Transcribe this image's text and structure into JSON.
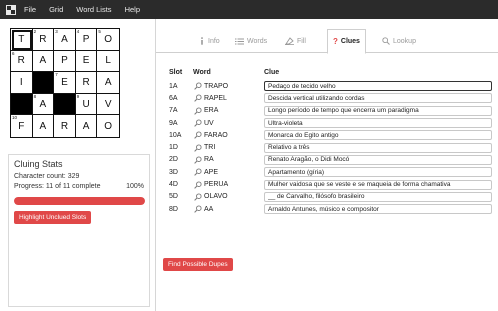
{
  "menu": {
    "items": [
      "File",
      "Grid",
      "Word Lists",
      "Help"
    ]
  },
  "grid": {
    "cells": [
      {
        "letter": "T",
        "num": "1",
        "black": false,
        "selected": true
      },
      {
        "letter": "R",
        "num": "2",
        "black": false
      },
      {
        "letter": "A",
        "num": "3",
        "black": false
      },
      {
        "letter": "P",
        "num": "4",
        "black": false
      },
      {
        "letter": "O",
        "num": "5",
        "black": false
      },
      {
        "letter": "R",
        "num": "6",
        "black": false
      },
      {
        "letter": "A",
        "num": "",
        "black": false
      },
      {
        "letter": "P",
        "num": "",
        "black": false
      },
      {
        "letter": "E",
        "num": "",
        "black": false
      },
      {
        "letter": "L",
        "num": "",
        "black": false
      },
      {
        "letter": "I",
        "num": "",
        "black": false
      },
      {
        "letter": "",
        "num": "",
        "black": true
      },
      {
        "letter": "E",
        "num": "7",
        "black": false
      },
      {
        "letter": "R",
        "num": "",
        "black": false
      },
      {
        "letter": "A",
        "num": "",
        "black": false
      },
      {
        "letter": "",
        "num": "",
        "black": true
      },
      {
        "letter": "A",
        "num": "8",
        "black": false
      },
      {
        "letter": "",
        "num": "",
        "black": true
      },
      {
        "letter": "U",
        "num": "9",
        "black": false
      },
      {
        "letter": "V",
        "num": "",
        "black": false
      },
      {
        "letter": "F",
        "num": "10",
        "black": false
      },
      {
        "letter": "A",
        "num": "",
        "black": false
      },
      {
        "letter": "R",
        "num": "",
        "black": false
      },
      {
        "letter": "A",
        "num": "",
        "black": false
      },
      {
        "letter": "O",
        "num": "",
        "black": false
      }
    ]
  },
  "stats": {
    "title": "Cluing Stats",
    "character_count": "Character count: 329",
    "progress_text": "Progress: 11 of 11 complete",
    "progress_percent": "100%",
    "progress_fraction": 1.0,
    "highlight_button": "Highlight Unclued Slots"
  },
  "tabs": [
    {
      "label": "Info",
      "icon": "info-icon",
      "active": false
    },
    {
      "label": "Words",
      "icon": "list-icon",
      "active": false
    },
    {
      "label": "Fill",
      "icon": "fill-icon",
      "active": false
    },
    {
      "label": "Clues",
      "icon": "question-icon",
      "active": true
    },
    {
      "label": "Lookup",
      "icon": "search-icon",
      "active": false
    }
  ],
  "clues": {
    "headers": {
      "slot": "Slot",
      "word": "Word",
      "clue": "Clue"
    },
    "rows": [
      {
        "slot": "1A",
        "word": "TRAPO",
        "clue": "Pedaço de tecido velho",
        "focused": true
      },
      {
        "slot": "6A",
        "word": "RAPEL",
        "clue": "Descida vertical utilizando cordas"
      },
      {
        "slot": "7A",
        "word": "ERA",
        "clue": "Longo período de tempo que encerra um paradigma"
      },
      {
        "slot": "9A",
        "word": "UV",
        "clue": "Ultra-violeta"
      },
      {
        "slot": "10A",
        "word": "FARAO",
        "clue": "Monarca do Egito antigo"
      },
      {
        "slot": "1D",
        "word": "TRI",
        "clue": "Relativo a três"
      },
      {
        "slot": "2D",
        "word": "RA",
        "clue": "Renato Aragão, o Didi Mocó"
      },
      {
        "slot": "3D",
        "word": "APE",
        "clue": "Apartamento (gíria)"
      },
      {
        "slot": "4D",
        "word": "PERUA",
        "clue": "Mulher vaidosa que se veste e se maqueia de forma chamativa"
      },
      {
        "slot": "5D",
        "word": "OLAVO",
        "clue": "__ de Carvalho, filósofo brasileiro"
      },
      {
        "slot": "8D",
        "word": "AA",
        "clue": "Arnaldo Antunes, músico e compositor"
      }
    ],
    "find_dupes_button": "Find Possible Dupes"
  },
  "colors": {
    "accent_red": "#e04848",
    "active_tab_icon": "#e04848",
    "menubar": "#2b2b2b"
  }
}
